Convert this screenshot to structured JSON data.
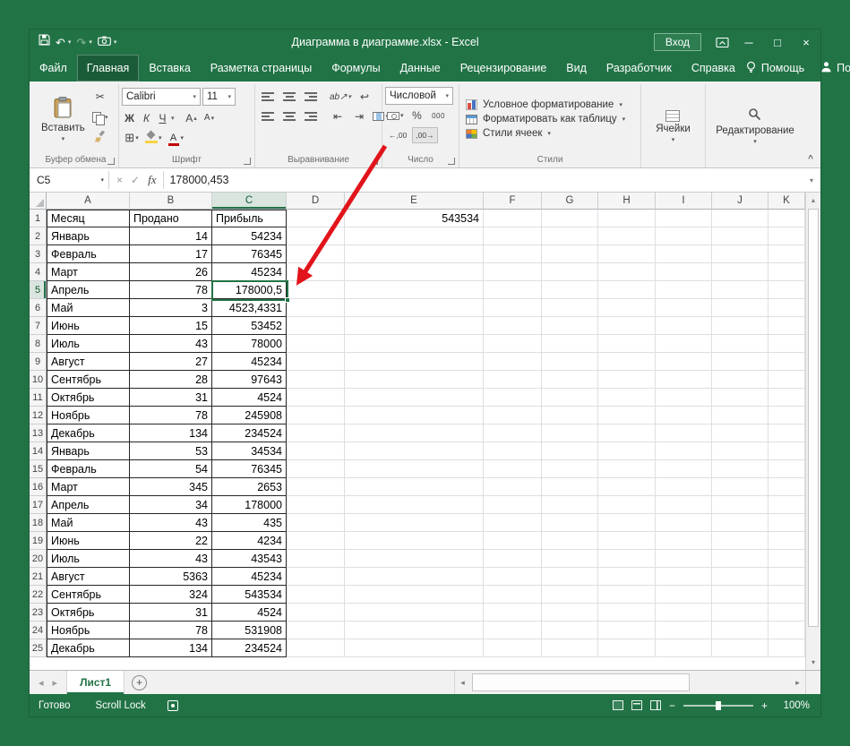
{
  "colors": {
    "brand": "#217346",
    "brand_dark": "#185C37",
    "arrow_red": "#E2141B"
  },
  "titlebar": {
    "title": "Диаграмма в диаграмме.xlsx  -  Excel",
    "sign_in": "Вход"
  },
  "tabs": [
    {
      "label": "Файл",
      "active": false
    },
    {
      "label": "Главная",
      "active": true
    },
    {
      "label": "Вставка",
      "active": false
    },
    {
      "label": "Разметка страницы",
      "active": false
    },
    {
      "label": "Формулы",
      "active": false
    },
    {
      "label": "Данные",
      "active": false
    },
    {
      "label": "Рецензирование",
      "active": false
    },
    {
      "label": "Вид",
      "active": false
    },
    {
      "label": "Разработчик",
      "active": false
    },
    {
      "label": "Справка",
      "active": false
    }
  ],
  "tab_extras": {
    "help": "Помощь",
    "share": "Поделиться"
  },
  "ribbon": {
    "clipboard": {
      "label": "Буфер обмена",
      "paste": "Вставить"
    },
    "font": {
      "label": "Шрифт",
      "family": "Calibri",
      "size": "11",
      "bold": "Ж",
      "italic": "К",
      "underline": "Ч",
      "letter": "А"
    },
    "alignment": {
      "label": "Выравнивание",
      "orientation": "ab↗"
    },
    "number": {
      "label": "Число",
      "format": "Числовой",
      "percent": "%",
      "thousands": "000",
      "inc_decimal": "←,00",
      "dec_decimal": ",00→"
    },
    "styles": {
      "label": "Стили",
      "items": [
        "Условное форматирование",
        "Форматировать как таблицу",
        "Стили ячеек"
      ]
    },
    "cells": {
      "label": "Ячейки"
    },
    "editing": {
      "label": "Редактирование"
    }
  },
  "icons": {
    "undo": "↶",
    "redo": "↷",
    "cut": "✂",
    "caret": "▾",
    "caret_up": "▴",
    "borders": "⊞",
    "check": "✓",
    "cancel": "×",
    "minimize": "─",
    "maximize": "□",
    "close": "×",
    "nav_left": "◂",
    "nav_right": "▸",
    "scroll_up": "▴",
    "scroll_down": "▾",
    "collapse_ribbon": "^",
    "plus": "+",
    "minus": "−",
    "indent_decrease": "⇤",
    "indent_increase": "⇥",
    "wrap_text": "↩"
  },
  "formula_bar": {
    "name_box": "C5",
    "fx": "fx",
    "value": "178000,453"
  },
  "grid": {
    "columns": [
      "A",
      "B",
      "C",
      "D",
      "E",
      "F",
      "G",
      "H",
      "I",
      "J",
      "K"
    ],
    "row_count": 25,
    "selected_cell": "C5",
    "selected_col": "C",
    "selected_row": 5,
    "e1_value": "543534",
    "table": {
      "headers": [
        "Месяц",
        "Продано",
        "Прибыль"
      ],
      "rows": [
        [
          "Январь",
          "14",
          "54234"
        ],
        [
          "Февраль",
          "17",
          "76345"
        ],
        [
          "Март",
          "26",
          "45234"
        ],
        [
          "Апрель",
          "78",
          "178000,5"
        ],
        [
          "Май",
          "3",
          "4523,4331"
        ],
        [
          "Июнь",
          "15",
          "53452"
        ],
        [
          "Июль",
          "43",
          "78000"
        ],
        [
          "Август",
          "27",
          "45234"
        ],
        [
          "Сентябрь",
          "28",
          "97643"
        ],
        [
          "Октябрь",
          "31",
          "4524"
        ],
        [
          "Ноябрь",
          "78",
          "245908"
        ],
        [
          "Декабрь",
          "134",
          "234524"
        ],
        [
          "Январь",
          "53",
          "34534"
        ],
        [
          "Февраль",
          "54",
          "76345"
        ],
        [
          "Март",
          "345",
          "2653"
        ],
        [
          "Апрель",
          "34",
          "178000"
        ],
        [
          "Май",
          "43",
          "435"
        ],
        [
          "Июнь",
          "22",
          "4234"
        ],
        [
          "Июль",
          "43",
          "43543"
        ],
        [
          "Август",
          "5363",
          "45234"
        ],
        [
          "Сентябрь",
          "324",
          "543534"
        ],
        [
          "Октябрь",
          "31",
          "4524"
        ],
        [
          "Ноябрь",
          "78",
          "531908"
        ],
        [
          "Декабрь",
          "134",
          "234524"
        ]
      ]
    }
  },
  "sheet": {
    "active_tab": "Лист1"
  },
  "statusbar": {
    "ready": "Готово",
    "scroll_lock": "Scroll Lock",
    "zoom": "100%"
  }
}
